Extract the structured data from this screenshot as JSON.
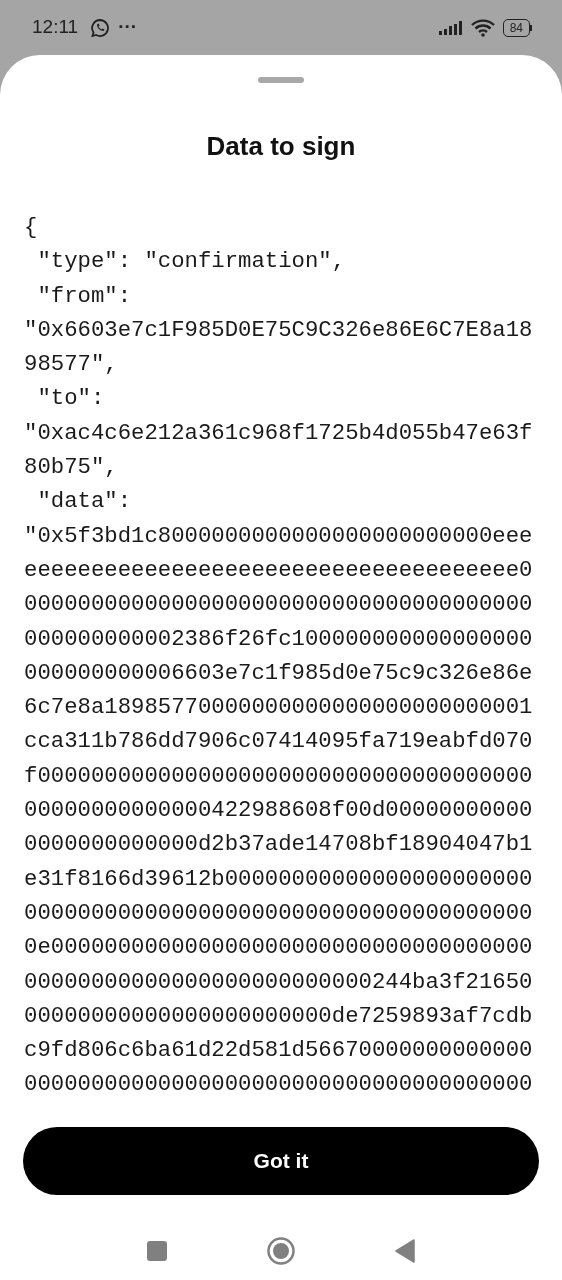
{
  "status_bar": {
    "time": "12:11",
    "more": "···",
    "battery": "84"
  },
  "sheet": {
    "title": "Data to sign",
    "code_lines": [
      "{",
      " \"type\": \"confirmation\",",
      " \"from\":",
      "\"0x6603e7c1F985D0E75C9C326e86E6C7E8a18",
      "98577\",",
      " \"to\":",
      "\"0xac4c6e212a361c968f1725b4d055b47e63f",
      "80b75\",",
      " \"data\":",
      "\"0x5f3bd1c8000000000000000000000000eee",
      "eeeeeeeeeeeeeeeeeeeeeeeeeeeeeeeeeeeee0",
      "00000000000000000000000000000000000000",
      "000000000002386f26fc100000000000000000",
      "000000000006603e7c1f985d0e75c9c326e86e",
      "6c7e8a18985770000000000000000000000001",
      "cca311b786dd7906c07414095fa719eabfd070",
      "f0000000000000000000000000000000000000",
      "00000000000000422988608f00d00000000000",
      "0000000000000d2b37ade14708bf18904047b1",
      "e31f8166d39612b00000000000000000000000",
      "00000000000000000000000000000000000000",
      "0e000000000000000000000000000000000000",
      "00000000000000000000000000244ba3f21650",
      "00000000000000000000000de7259893af7cdb",
      "c9fd806c6ba61d22d581d56670000000000000",
      "00000000000000000000000000000000000000"
    ],
    "button": "Got it"
  }
}
